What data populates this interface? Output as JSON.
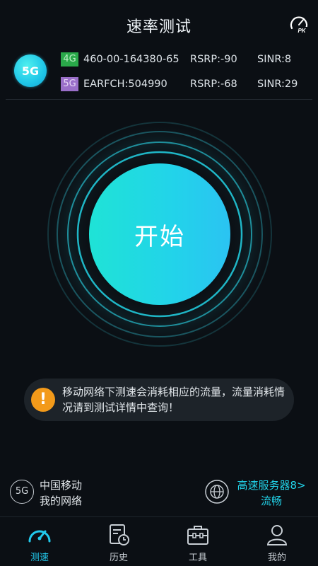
{
  "header": {
    "title": "速率测试",
    "pk_label": "PK"
  },
  "network": {
    "badge": "5G",
    "rows": [
      {
        "tag": "4G",
        "id": "460-00-164380-65",
        "rsrp": "RSRP:-90",
        "sinr": "SINR:8"
      },
      {
        "tag": "5G",
        "id": "EARFCH:504990",
        "rsrp": "RSRP:-68",
        "sinr": "SINR:29"
      }
    ]
  },
  "main": {
    "start_label": "开始"
  },
  "notice": {
    "icon": "!",
    "text": "移动网络下测速会消耗相应的流量，流量消耗情况请到测试详情中查询！"
  },
  "operator": {
    "icon_label": "5G",
    "name": "中国移动",
    "network": "我的网络",
    "server_line1": "高速服务器8>",
    "server_line2": "流畅"
  },
  "tabs": [
    {
      "label": "测速",
      "icon": "speedometer-icon",
      "active": true
    },
    {
      "label": "历史",
      "icon": "history-icon",
      "active": false
    },
    {
      "label": "工具",
      "icon": "toolbox-icon",
      "active": false
    },
    {
      "label": "我的",
      "icon": "user-icon",
      "active": false
    }
  ],
  "colors": {
    "accent": "#22d3ea",
    "background": "#0b0f14",
    "warning": "#f39a1a",
    "tag4g": "#2aa94a",
    "tag5g": "#9a6fc9"
  }
}
